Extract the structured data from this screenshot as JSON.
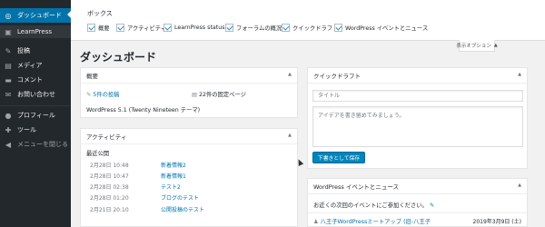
{
  "sidebar": {
    "items": [
      {
        "label": "ダッシュボード",
        "icon": "dashboard-icon",
        "glyph": "◎"
      },
      {
        "label": "LearnPress",
        "icon": "learnpress-icon",
        "glyph": "▣"
      },
      {
        "label": "投稿",
        "icon": "pin-icon",
        "glyph": "✎"
      },
      {
        "label": "メディア",
        "icon": "media-icon",
        "glyph": "▤"
      },
      {
        "label": "コメント",
        "icon": "comment-icon",
        "glyph": "▬"
      },
      {
        "label": "お問い合わせ",
        "icon": "mail-icon",
        "glyph": "✉"
      },
      {
        "label": "プロフィール",
        "icon": "user-icon",
        "glyph": "●"
      },
      {
        "label": "ツール",
        "icon": "wrench-icon",
        "glyph": "✚"
      },
      {
        "label": "メニューを閉じる",
        "icon": "collapse-icon",
        "glyph": "◀"
      }
    ]
  },
  "screen_options": {
    "title": "ボックス",
    "checkboxes": [
      "概要",
      "アクティビティ",
      "LearnPress status",
      "フォーラムの概況",
      "クイックドラフト",
      "WordPress イベントとニュース"
    ],
    "tab_label": "表示オプション"
  },
  "page_title": "ダッシュボード",
  "overview": {
    "title": "概要",
    "posts": "5件の投稿",
    "pages": "22件の固定ページ",
    "version": "WordPress 5.1 (Twenty Nineteen テーマ)"
  },
  "activity": {
    "title": "アクティビティ",
    "subtitle": "最近公開",
    "rows": [
      {
        "date": "2月28日 10:48",
        "title": "新着情報2"
      },
      {
        "date": "2月28日 10:47",
        "title": "新着情報1"
      },
      {
        "date": "2月28日 02:38",
        "title": "テスト2"
      },
      {
        "date": "2月28日 01:20",
        "title": "ブログのテスト"
      },
      {
        "date": "2月21日 20:10",
        "title": "公開投稿のテスト"
      }
    ]
  },
  "quick_draft": {
    "title": "クイックドラフト",
    "title_placeholder": "タイトル",
    "content_placeholder": "アイデアを書き留めてみましょう。",
    "save_label": "下書きとして保存"
  },
  "events": {
    "title": "WordPress イベントとニュース",
    "intro": "お近くの次回のイベントにご参加ください。",
    "event_title": "八王子WordPressミートアップ (旧-八王子",
    "event_date": "2019年3月9日 (土)"
  }
}
